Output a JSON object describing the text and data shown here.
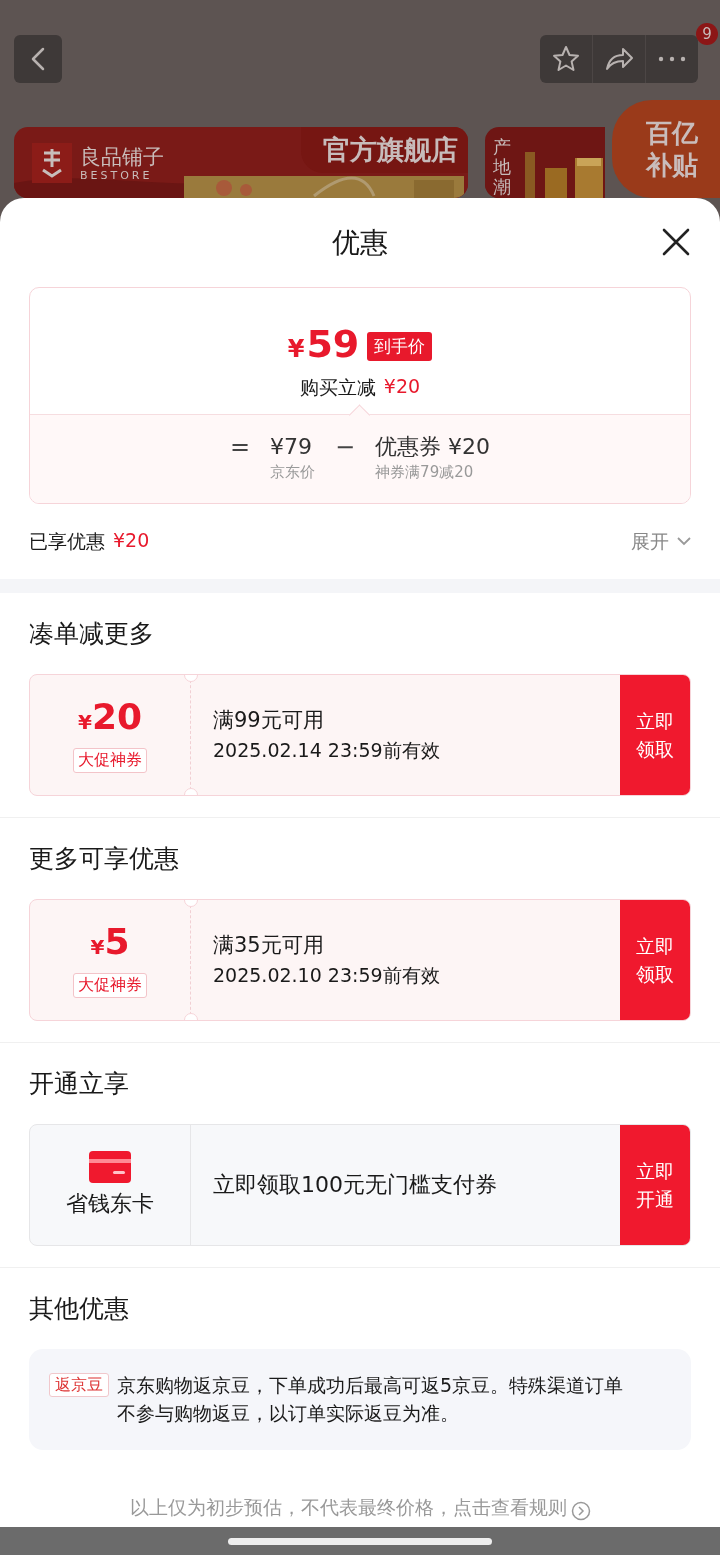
{
  "backdrop": {
    "notification_badge": "9",
    "store_banner": {
      "brand": "良品铺子",
      "brand_en": "BESTORE",
      "label": "官方旗舰店"
    },
    "side_banner": {
      "tagline": "产地潮",
      "badge_top": "百亿",
      "badge_bottom": "补贴"
    }
  },
  "sheet": {
    "title": "优惠"
  },
  "price_card": {
    "currency": "¥",
    "amount": "59",
    "tag": "到手价",
    "saving_label": "购买立减",
    "saving_amount": "¥20",
    "breakdown": [
      {
        "kind": "operator",
        "text": "="
      },
      {
        "kind": "term",
        "value": "¥79",
        "caption": "京东价"
      },
      {
        "kind": "operator",
        "text": "−"
      },
      {
        "kind": "term",
        "value": "优惠券 ¥20",
        "caption": "神券满79减20"
      }
    ]
  },
  "enjoyed": {
    "label": "已享优惠",
    "amount": "¥20"
  },
  "expand": {
    "label": "展开",
    "expanded": false
  },
  "sections": [
    {
      "heading": "凑单减更多",
      "card": {
        "kind": "coupon",
        "currency": "¥",
        "amount": "20",
        "tag": "大促神券",
        "condition": "满99元可用",
        "validity": "2025.02.14 23:59前有效",
        "action": "立即领取"
      }
    },
    {
      "heading": "更多可享优惠",
      "card": {
        "kind": "coupon",
        "currency": "¥",
        "amount": "5",
        "tag": "大促神券",
        "condition": "满35元可用",
        "validity": "2025.02.10 23:59前有效",
        "action": "立即领取"
      }
    },
    {
      "heading": "开通立享",
      "card": {
        "kind": "membership",
        "name": "省钱东卡",
        "text": "立即领取100元无门槛支付券",
        "action": "立即开通"
      }
    },
    {
      "heading": "其他优惠",
      "card": {
        "kind": "info",
        "tag": "返京豆",
        "text": "京东购物返京豆，下单成功后最高可返5京豆。特殊渠道订单不参与购物返豆，以订单实际返豆为准。"
      }
    }
  ],
  "footer": {
    "text": "以上仅为初步预估，不代表最终价格，点击查看规则"
  }
}
